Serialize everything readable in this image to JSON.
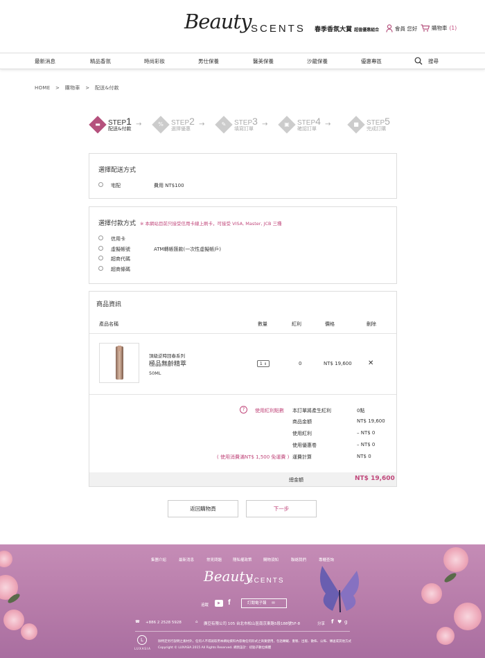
{
  "header": {
    "logo_script": "Beauty",
    "logo_scents": "SCENTS",
    "promo_title": "春季香氛大賞",
    "promo_sub": "超值優惠組合",
    "member_label": "會員 您好",
    "cart_label": "購物車",
    "cart_count": "(1)"
  },
  "nav": {
    "items": [
      "最新消息",
      "精品香氛",
      "時尚彩妝",
      "男仕保養",
      "醫美保養",
      "沙龍保養",
      "優惠專區"
    ],
    "search_label": "搜尋"
  },
  "breadcrumb": {
    "home": "HOME",
    "sep": ">",
    "cart": "購物車",
    "current": "配送&付款"
  },
  "steps": [
    {
      "label": "STEP",
      "num": "1",
      "sub": "配送&付款"
    },
    {
      "label": "STEP",
      "num": "2",
      "sub": "選擇優惠"
    },
    {
      "label": "STEP",
      "num": "3",
      "sub": "填寫訂單"
    },
    {
      "label": "STEP",
      "num": "4",
      "sub": "確認訂單"
    },
    {
      "label": "STEP",
      "num": "5",
      "sub": "完成訂購"
    }
  ],
  "shipping": {
    "title": "選擇配送方式",
    "option": "宅配",
    "fee": "費用 NT$100"
  },
  "payment": {
    "title": "選擇付款方式",
    "note": "※ 本網站目前只接受信用卡線上刷卡，可接受 VISA, Master, JCB 三種",
    "options": [
      "信用卡",
      "虛擬帳號",
      "超商代碼",
      "超商條碼"
    ],
    "atm_note": "ATM轉帳匯款(一次性虛擬帳戶)"
  },
  "products": {
    "title": "商品資訊",
    "headers": {
      "name": "產品名稱",
      "qty": "數量",
      "bonus": "紅利",
      "price": "價格",
      "delete": "刪除"
    },
    "item": {
      "series": "頂級逆時回春系列",
      "name": "極品無齡精萃",
      "size": "50ML",
      "qty": "1",
      "bonus": "0",
      "price": "NT$ 19,600",
      "delete": "✕"
    }
  },
  "summary": {
    "use_points": "使用紅利點數",
    "shipping_note": "( 使用消費滿NT$ 1,500 免運費 )",
    "rows": [
      {
        "label": "本訂單將產生紅利",
        "value": "0點"
      },
      {
        "label": "商品金額",
        "value": "NT$ 19,600"
      },
      {
        "label": "使用紅利",
        "value": "– NT$ 0"
      },
      {
        "label": "使用優惠卷",
        "value": "– NT$ 0"
      },
      {
        "label": "運費計算",
        "value": "NT$ 0"
      }
    ],
    "total_label": "總金額",
    "total_value": "NT$ 19,600"
  },
  "buttons": {
    "back": "返回購物頁",
    "next": "下一步"
  },
  "footer": {
    "links": [
      "集團介紹",
      "最新消息",
      "常見問題",
      "隱私權政策",
      "購物須知",
      "聯絡我們",
      "專櫃查詢"
    ],
    "logo_script": "Beauty",
    "logo_scents": "SCENTS",
    "follow": "追蹤",
    "newsletter": "訂閱電子報",
    "phone": "+886 2 2528 5928",
    "address": "廣亞有限公司 105 台北市松山區南京東路5段188號5F-8",
    "share": "分享",
    "disclaimer": "除特定另行說明之素材外，任何人不得就取用本網站資料內容做任何形式之商業使用，包括轉載、重製、出版、散佈、公佈、傳送或其他方式",
    "copyright": "Copyright © LUXASIA 2015 All Rights Reserved. 網頁設計：初點子數位媒體",
    "brand": "LUXASIA"
  },
  "colors": {
    "accent": "#c0467a",
    "step_active": "#b5517d",
    "footer": "#b57aa8"
  }
}
